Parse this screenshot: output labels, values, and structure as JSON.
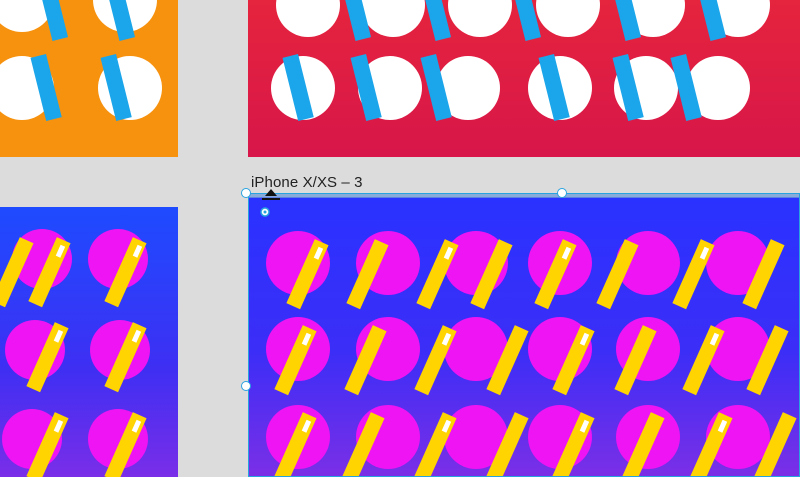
{
  "canvas": {
    "selected_artboard_label": "iPhone X/XS – 3"
  },
  "artboards": [
    {
      "id": "orange",
      "pattern": "white-circles-blue-bars",
      "bg": "#f7920f"
    },
    {
      "id": "red",
      "pattern": "white-circles-blue-bars",
      "bg": "#e5243d"
    },
    {
      "id": "blue-left",
      "pattern": "magenta-circles-yellow-bars",
      "bg": "#1e4bff"
    },
    {
      "id": "blue-main",
      "pattern": "magenta-circles-yellow-bars",
      "bg": "#2a32ff",
      "selected": true
    }
  ],
  "colors": {
    "selection": "#29a3e0",
    "white_circle": "#ffffff",
    "blue_bar": "#1ba5ea",
    "magenta_circle": "#ee14f3",
    "yellow_bar": "#ffd400"
  },
  "icons": {
    "rotate_handle": "rotate-handle-icon",
    "resize_handle": "resize-handle-icon"
  }
}
